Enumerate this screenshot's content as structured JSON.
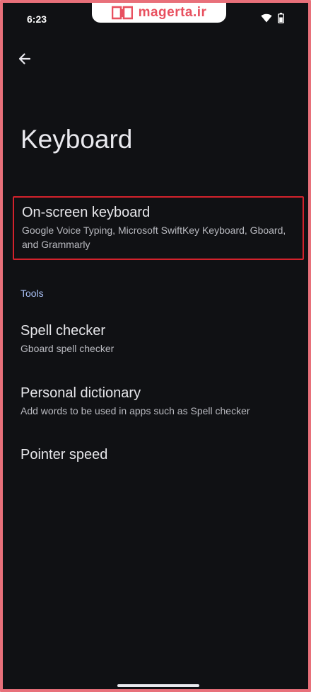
{
  "status_bar": {
    "time": "6:23",
    "watermark": "magerta.ir",
    "icons": [
      "wifi-icon",
      "battery-icon"
    ]
  },
  "header": {
    "back_icon": "arrow-left-icon",
    "title": "Keyboard"
  },
  "items": [
    {
      "title": "On-screen keyboard",
      "subtitle": "Google Voice Typing, Microsoft SwiftKey Keyboard, Gboard, and Grammarly"
    }
  ],
  "tools": {
    "header": "Tools",
    "items": [
      {
        "title": "Spell checker",
        "subtitle": "Gboard spell checker"
      },
      {
        "title": "Personal dictionary",
        "subtitle": "Add words to be used in apps such as Spell checker"
      },
      {
        "title": "Pointer speed"
      }
    ]
  },
  "colors": {
    "background": "#101114",
    "frame_border": "#e8707a",
    "highlight_border": "#d3222c",
    "section_accent": "#a9c0f5",
    "watermark_text": "#e8505f"
  }
}
